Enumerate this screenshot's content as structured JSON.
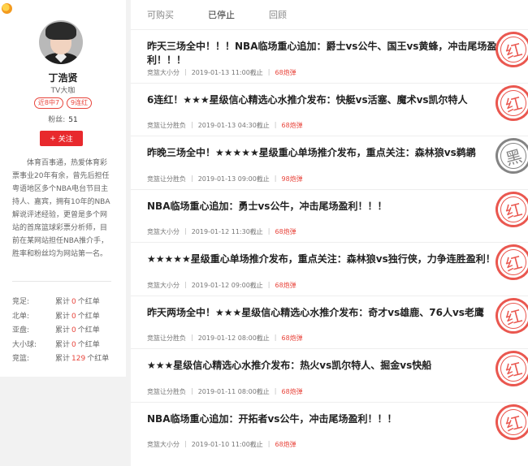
{
  "profile": {
    "name": "丁浩贤",
    "title": "TV大咖",
    "badges": [
      "近8中7",
      "9连红"
    ],
    "fans_label": "粉丝:",
    "fans_count": "51",
    "follow_label": "关注",
    "bio": "体育百事通，热爱体育彩票事业20年有余，曾先后担任粤语地区多个NBA电台节目主持人、嘉宾，拥有10年的NBA解说评述经验，更曾是多个网站的首席篮球彩票分析师，目前在某网站担任NBA推介手，胜率和粉丝均为网站第一名。",
    "stats": [
      {
        "label": "竞足:",
        "prefix": "累计",
        "count": "0",
        "suffix": "个红单"
      },
      {
        "label": "北单:",
        "prefix": "累计",
        "count": "0",
        "suffix": "个红单"
      },
      {
        "label": "亚盘:",
        "prefix": "累计",
        "count": "0",
        "suffix": "个红单"
      },
      {
        "label": "大小球:",
        "prefix": "累计",
        "count": "0",
        "suffix": "个红单"
      },
      {
        "label": "竞篮:",
        "prefix": "累计",
        "count": "129",
        "suffix": "个红单"
      }
    ]
  },
  "tabs": [
    "可购买",
    "已停止",
    "回顾"
  ],
  "active_tab": "已停止",
  "items": [
    {
      "title": "昨天三场全中！！！NBA临场重心追加：爵士vs公牛、国王vs黄蜂，冲击尾场盈利！！！",
      "type": "竞篮大小分",
      "time": "2019-01-13 11:00截止",
      "cost": "68炮弹",
      "result": "红"
    },
    {
      "title": "6连红！★★★星级信心精选心水推介发布：快艇vs活塞、魔术vs凯尔特人",
      "type": "竞篮让分胜负",
      "time": "2019-01-13 04:30截止",
      "cost": "68炮弹",
      "result": "红"
    },
    {
      "title": "昨晚三场全中！★★★★★星级重心单场推介发布，重点关注：森林狼vs鹈鹕",
      "type": "竞篮让分胜负",
      "time": "2019-01-13 09:00截止",
      "cost": "98炮弹",
      "result": "黑"
    },
    {
      "title": "NBA临场重心追加：勇士vs公牛，冲击尾场盈利！！！",
      "type": "竞篮大小分",
      "time": "2019-01-12 11:30截止",
      "cost": "68炮弹",
      "result": "红"
    },
    {
      "title": "★★★★★星级重心单场推介发布，重点关注：森林狼vs独行侠，力争连胜盈利！",
      "type": "竞篮大小分",
      "time": "2019-01-12 09:00截止",
      "cost": "68炮弹",
      "result": "红"
    },
    {
      "title": "昨天两场全中！★★★星级信心精选心水推介发布：奇才vs雄鹿、76人vs老鹰",
      "type": "竞篮让分胜负",
      "time": "2019-01-12 08:00截止",
      "cost": "68炮弹",
      "result": "红"
    },
    {
      "title": "★★★星级信心精选心水推介发布：热火vs凯尔特人、掘金vs快船",
      "type": "竞篮让分胜负",
      "time": "2019-01-11 08:00截止",
      "cost": "68炮弹",
      "result": "红"
    },
    {
      "title": "NBA临场重心追加：开拓者vs公牛，冲击尾场盈利！！！",
      "type": "竞篮大小分",
      "time": "2019-01-10 11:00截止",
      "cost": "68炮弹",
      "result": "红"
    }
  ]
}
